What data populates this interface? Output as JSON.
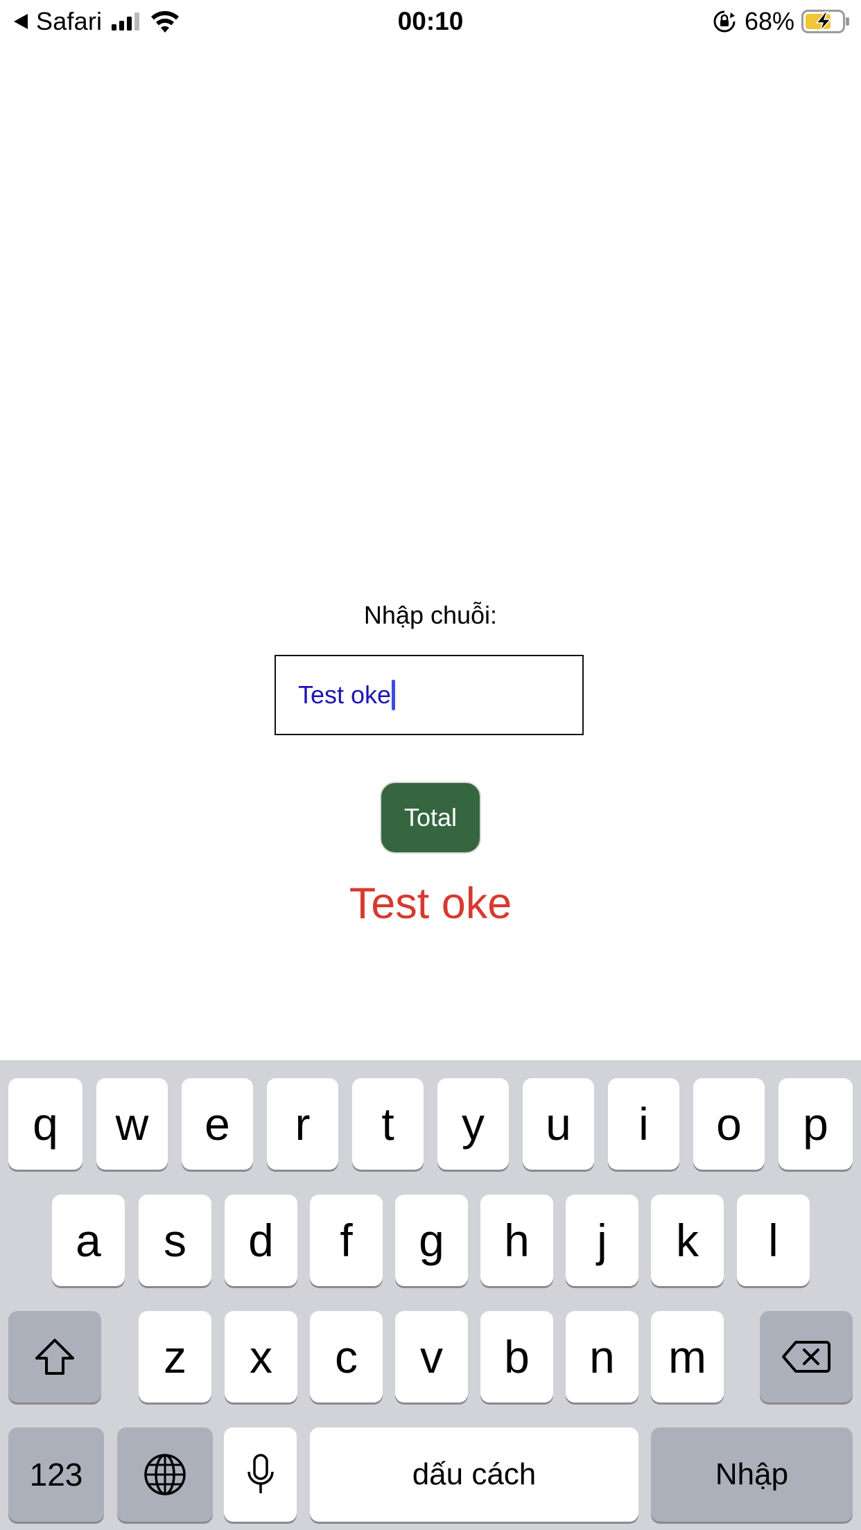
{
  "status_bar": {
    "back_app": "Safari",
    "time": "00:10",
    "battery_percent": "68%",
    "icons": [
      "back-arrow-icon",
      "cellular-signal-icon",
      "wifi-icon",
      "rotation-lock-icon",
      "battery-charging-icon"
    ]
  },
  "form": {
    "label": "Nhập chuỗi:",
    "input_value": "Test oke",
    "button_label": "Total",
    "result": "Test oke"
  },
  "colors": {
    "button_bg": "#366640",
    "result_text": "#d63a2f",
    "input_text": "#1a16b4",
    "keyboard_bg": "#d2d3d8"
  },
  "keyboard": {
    "row1": [
      "q",
      "w",
      "e",
      "r",
      "t",
      "y",
      "u",
      "i",
      "o",
      "p"
    ],
    "row2": [
      "a",
      "s",
      "d",
      "f",
      "g",
      "h",
      "j",
      "k",
      "l"
    ],
    "row3": [
      "z",
      "x",
      "c",
      "v",
      "b",
      "n",
      "m"
    ],
    "numbers_key": "123",
    "space_key": "dấu cách",
    "return_key": "Nhập",
    "special_icons": [
      "shift-icon",
      "backspace-icon",
      "globe-icon",
      "microphone-icon"
    ]
  }
}
